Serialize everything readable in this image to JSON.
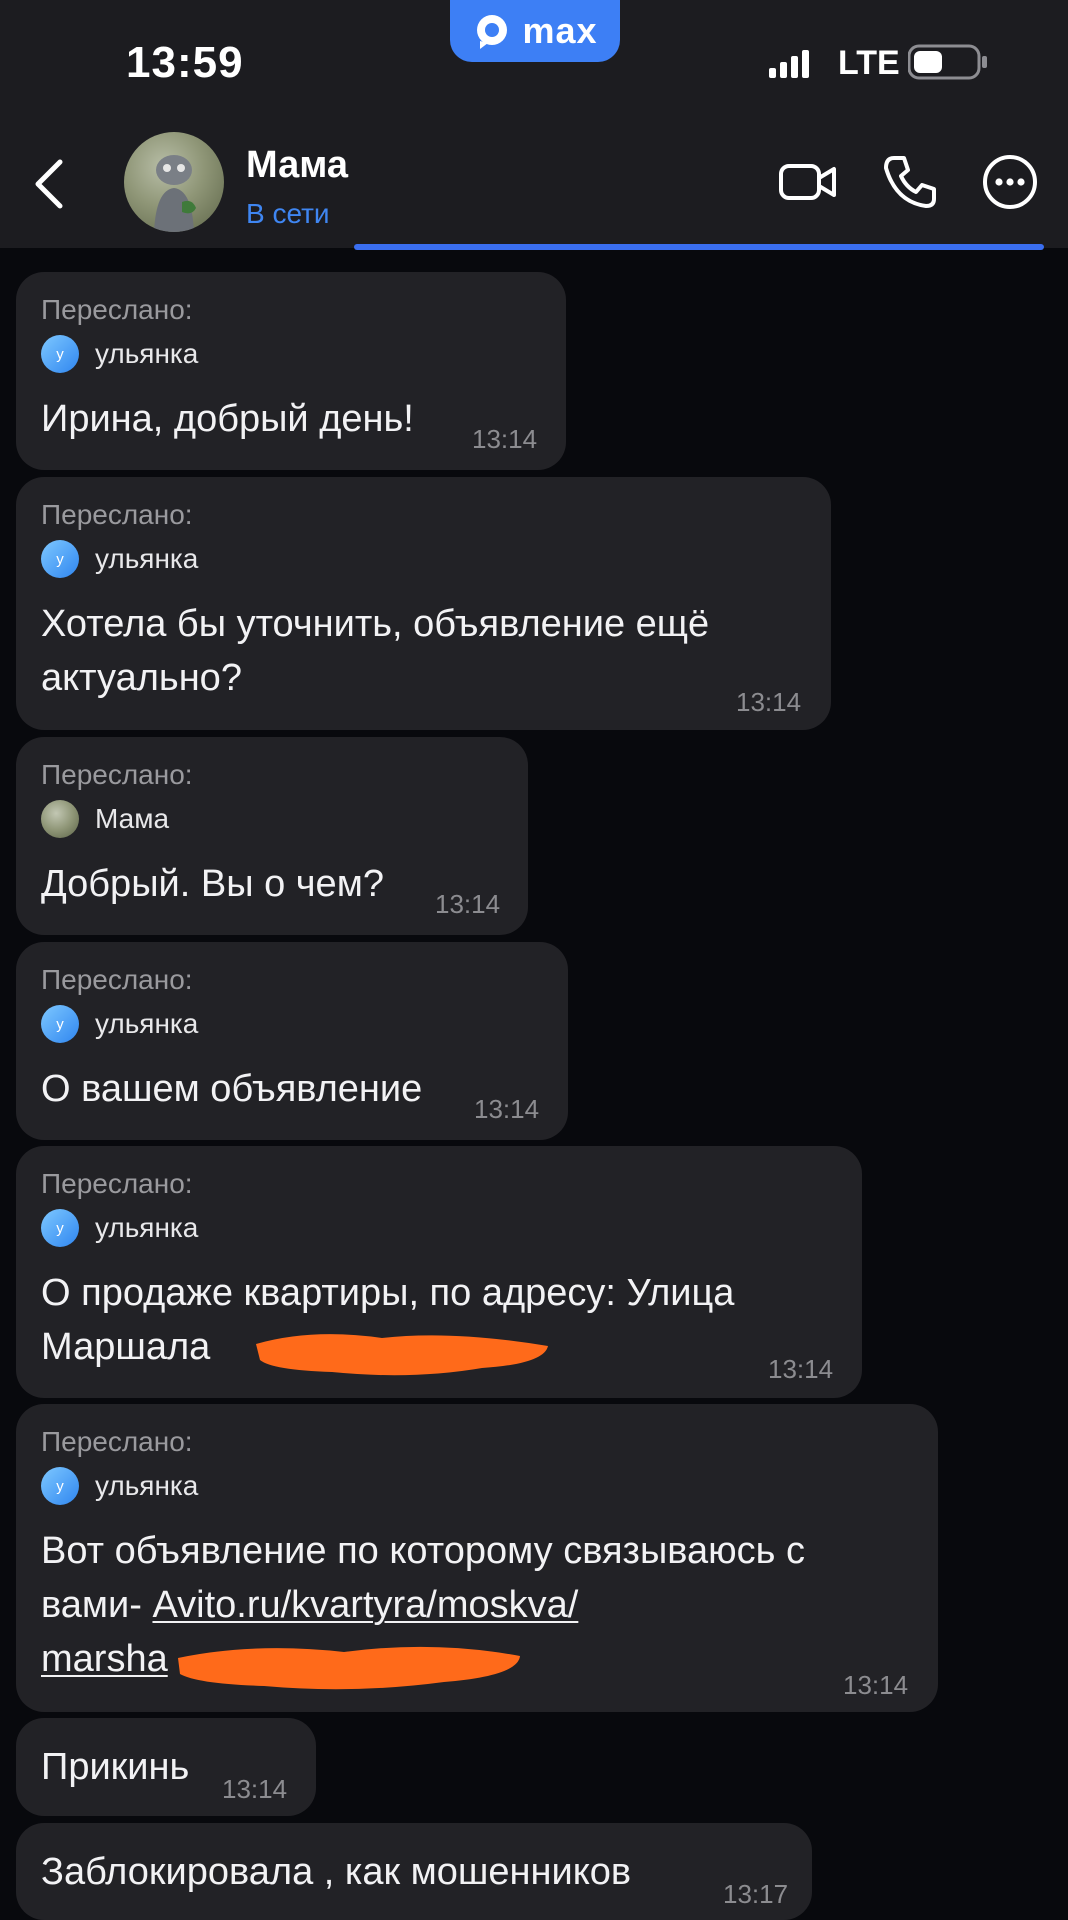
{
  "status_bar": {
    "time": "13:59",
    "app_badge": "max",
    "network": "LTE",
    "icons": [
      "signal-icon",
      "battery-icon"
    ]
  },
  "header": {
    "contact_name": "Мама",
    "status": "В сети",
    "icons": [
      "back-chevron-icon",
      "video-camera-icon",
      "phone-icon",
      "more-dots-icon"
    ],
    "status_color": "#3f86f2"
  },
  "messages": [
    {
      "forwarded_label": "Переслано:",
      "sender": "ульянка",
      "sender_initial": "у",
      "text": "Ирина, добрый день!",
      "time": "13:14"
    },
    {
      "forwarded_label": "Переслано:",
      "sender": "ульянка",
      "sender_initial": "у",
      "text_lines": [
        "Хотела бы уточнить, объявление ещё",
        "актуально?"
      ],
      "time": "13:14"
    },
    {
      "forwarded_label": "Переслано:",
      "sender": "Мама",
      "text": "Добрый. Вы о чем?",
      "time": "13:14"
    },
    {
      "forwarded_label": "Переслано:",
      "sender": "ульянка",
      "sender_initial": "у",
      "text": "О вашем объявление",
      "time": "13:14"
    },
    {
      "forwarded_label": "Переслано:",
      "sender": "ульянка",
      "sender_initial": "у",
      "text_lines": [
        "О продаже квартиры, по адресу: Улица",
        "Маршала"
      ],
      "time": "13:14"
    },
    {
      "forwarded_label": "Переслано:",
      "sender": "ульянка",
      "sender_initial": "у",
      "text_line1": "Вот объявление по которому связываюсь с",
      "text_line2_prefix": "вами- ",
      "link_line1": "Avito.ru/kvartyra/moskva/",
      "link_line2": "marsha",
      "time": "13:14"
    },
    {
      "text": "Прикинь",
      "time": "13:14"
    },
    {
      "text": "Заблокировала , как мошенников",
      "time": "13:17"
    }
  ],
  "colors": {
    "background": "#08090d",
    "bubble": "#222226",
    "accent": "#3d7ff5",
    "redaction": "#ff6a1a"
  }
}
